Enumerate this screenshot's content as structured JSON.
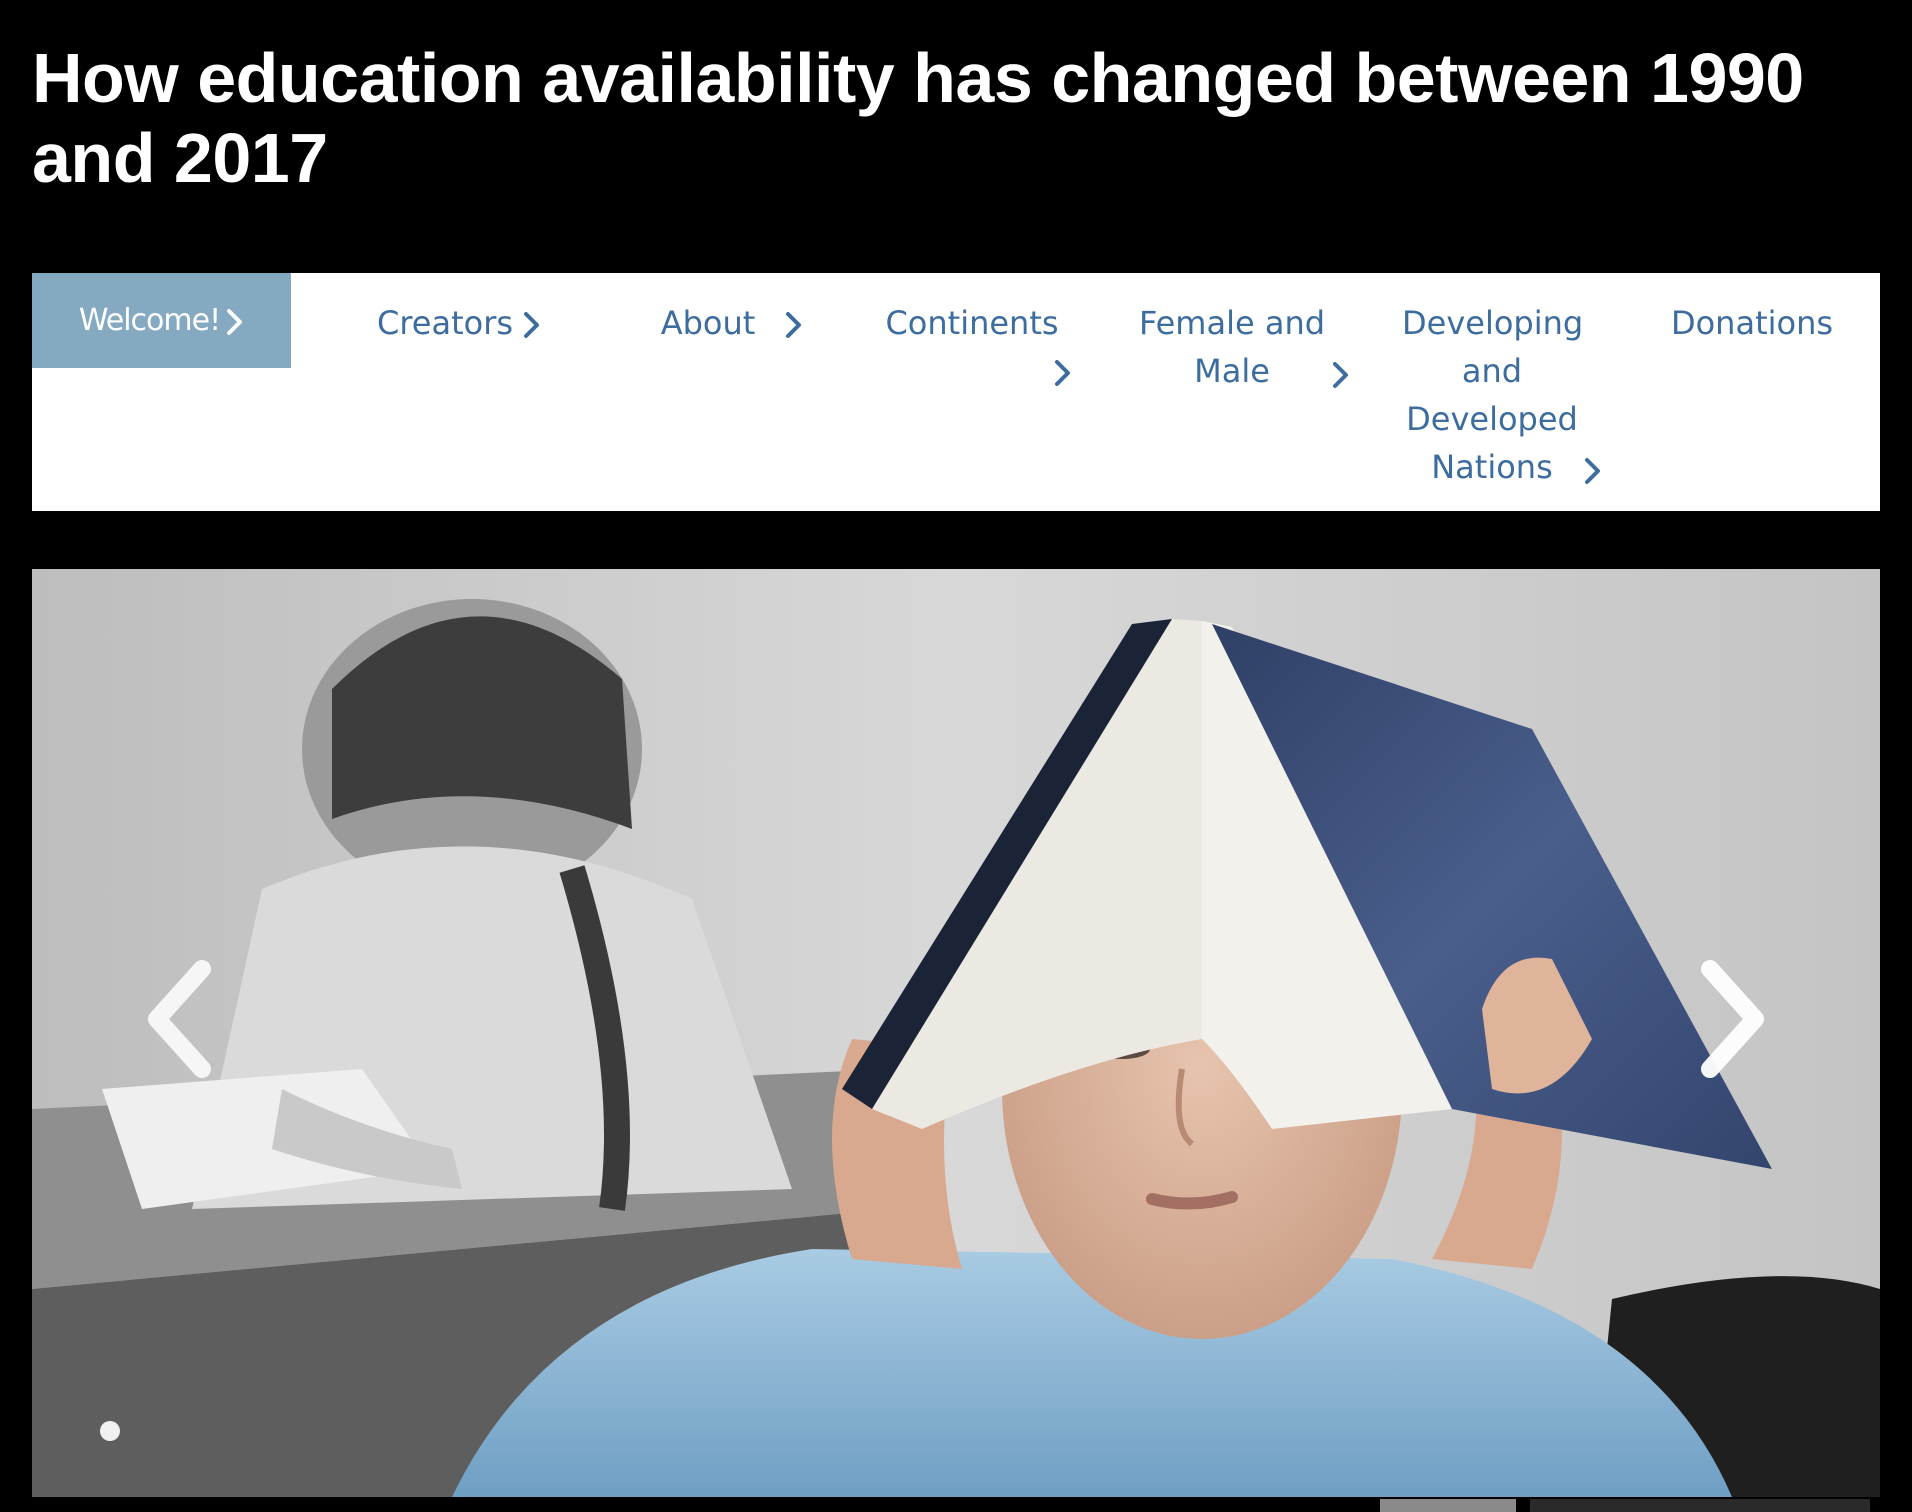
{
  "page": {
    "title": "How education availability has changed between 1990 and 2017"
  },
  "nav": {
    "items": [
      {
        "id": "welcome",
        "label": "Welcome!",
        "active": true
      },
      {
        "id": "creators",
        "label": "Creators",
        "active": false
      },
      {
        "id": "about",
        "label": "About",
        "active": false
      },
      {
        "id": "continents",
        "label": "Continents",
        "active": false
      },
      {
        "id": "female-and-male",
        "label": "Female and Male",
        "active": false
      },
      {
        "id": "developing-and-developed-nations",
        "label": "Developing and Developed Nations",
        "active": false
      },
      {
        "id": "donations",
        "label": "Donations",
        "active": false
      }
    ]
  },
  "carousel": {
    "prev_icon": "chevron-left-icon",
    "next_icon": "chevron-right-icon"
  },
  "colors": {
    "background": "#000000",
    "title": "#ffffff",
    "nav_background": "#ffffff",
    "nav_active_background": "#85a9c1",
    "nav_link": "#3d6c9e",
    "book_cover": "#3c4f7a",
    "shirt": "#8fbad8"
  }
}
